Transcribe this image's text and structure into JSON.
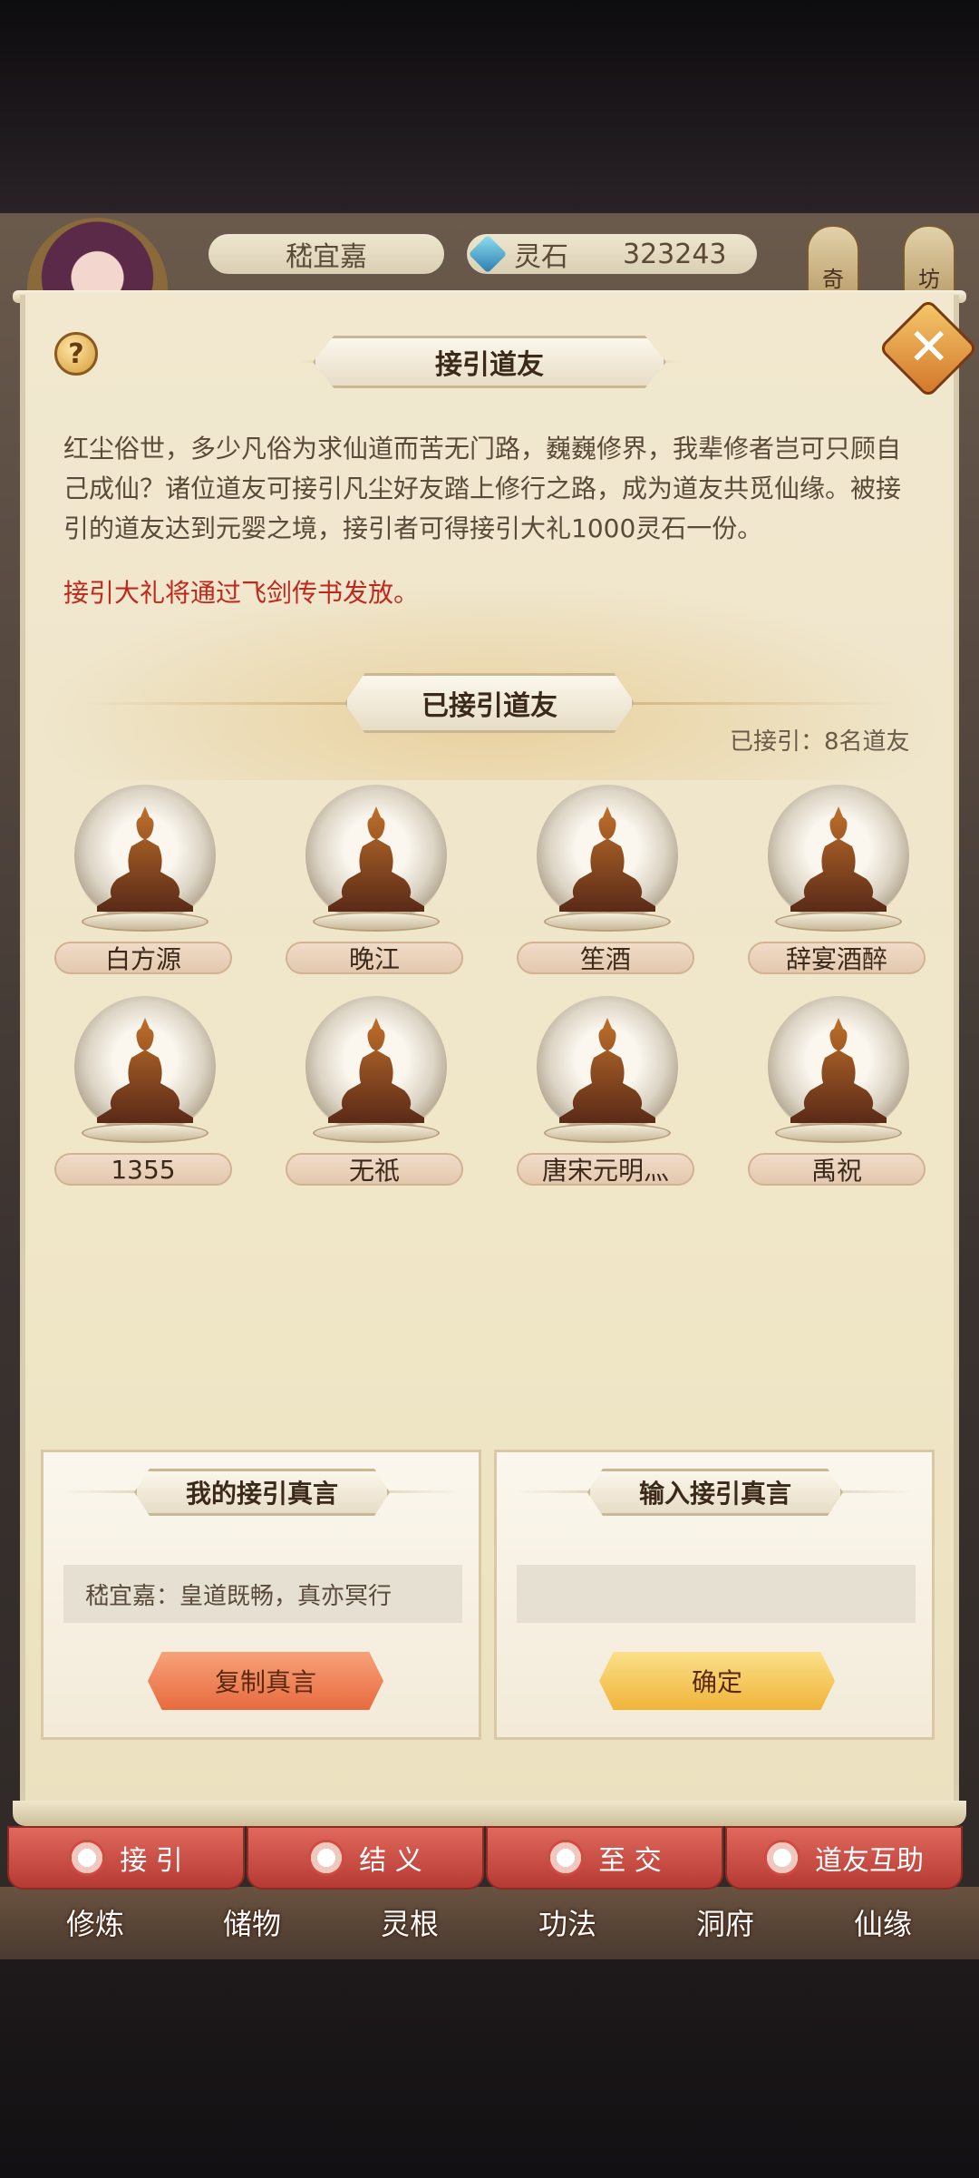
{
  "header": {
    "player_name": "嵇宜嘉",
    "currency_label": "灵石",
    "currency_value": "323243",
    "side_button_1": "奇",
    "side_button_2": "坊"
  },
  "dialog": {
    "title": "接引道友",
    "intro": "红尘俗世，多少凡俗为求仙道而苦无门路，巍巍修界，我辈修者岂可只顾自己成仙？诸位道友可接引凡尘好友踏上修行之路，成为道友共觅仙缘。被接引的道友达到元婴之境，接引者可得接引大礼1000灵石一份。",
    "notice": "接引大礼将通过飞剑传书发放。",
    "list_title": "已接引道友",
    "count_text": "已接引：8名道友",
    "friends": [
      {
        "name": "白方源"
      },
      {
        "name": "晚江"
      },
      {
        "name": "笙酒"
      },
      {
        "name": "辞宴酒醉"
      },
      {
        "name": "1355"
      },
      {
        "name": "无祇"
      },
      {
        "name": "唐宋元明灬"
      },
      {
        "name": "禹祝"
      }
    ],
    "my_code_panel": {
      "title": "我的接引真言",
      "code_text": "嵇宜嘉：皇道既畅，真亦冥行",
      "button": "复制真言"
    },
    "input_code_panel": {
      "title": "输入接引真言",
      "input_value": "",
      "button": "确定"
    }
  },
  "tabs": [
    {
      "label": "接 引"
    },
    {
      "label": "结 义"
    },
    {
      "label": "至 交"
    },
    {
      "label": "道友互助"
    }
  ],
  "bottom_nav": [
    {
      "label": "修炼"
    },
    {
      "label": "储物"
    },
    {
      "label": "灵根"
    },
    {
      "label": "功法"
    },
    {
      "label": "洞府"
    },
    {
      "label": "仙缘"
    }
  ],
  "colors": {
    "notice_red": "#c0281e",
    "tab_red": "#c84a42",
    "copy_button": "#f0865a",
    "confirm_button": "#f5c24e"
  }
}
